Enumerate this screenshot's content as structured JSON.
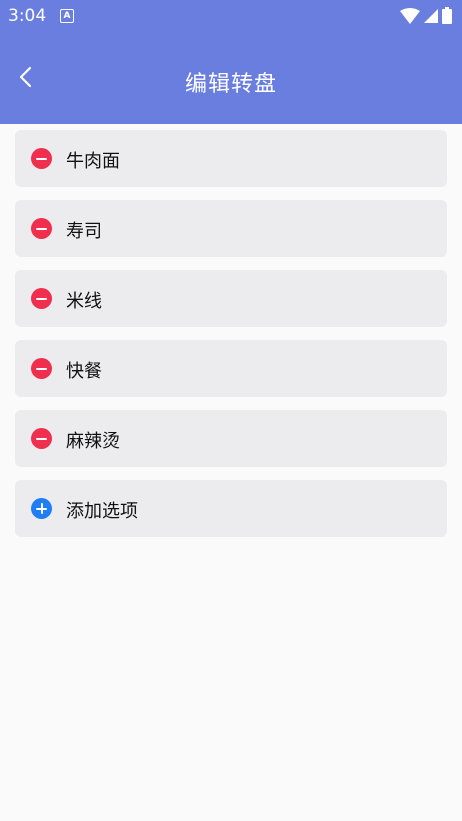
{
  "status": {
    "time": "3:04",
    "notification_icon": "A"
  },
  "header": {
    "title": "编辑转盘",
    "back_icon": "back-arrow"
  },
  "items": [
    {
      "label": "牛肉面",
      "action": "remove"
    },
    {
      "label": "寿司",
      "action": "remove"
    },
    {
      "label": "米线",
      "action": "remove"
    },
    {
      "label": "快餐",
      "action": "remove"
    },
    {
      "label": "麻辣烫",
      "action": "remove"
    }
  ],
  "add_item": {
    "label": "添加选项"
  },
  "colors": {
    "primary": "#6a7ee0",
    "remove": "#ef2f4d",
    "add": "#1f7ef6",
    "item_bg": "#ececee"
  }
}
